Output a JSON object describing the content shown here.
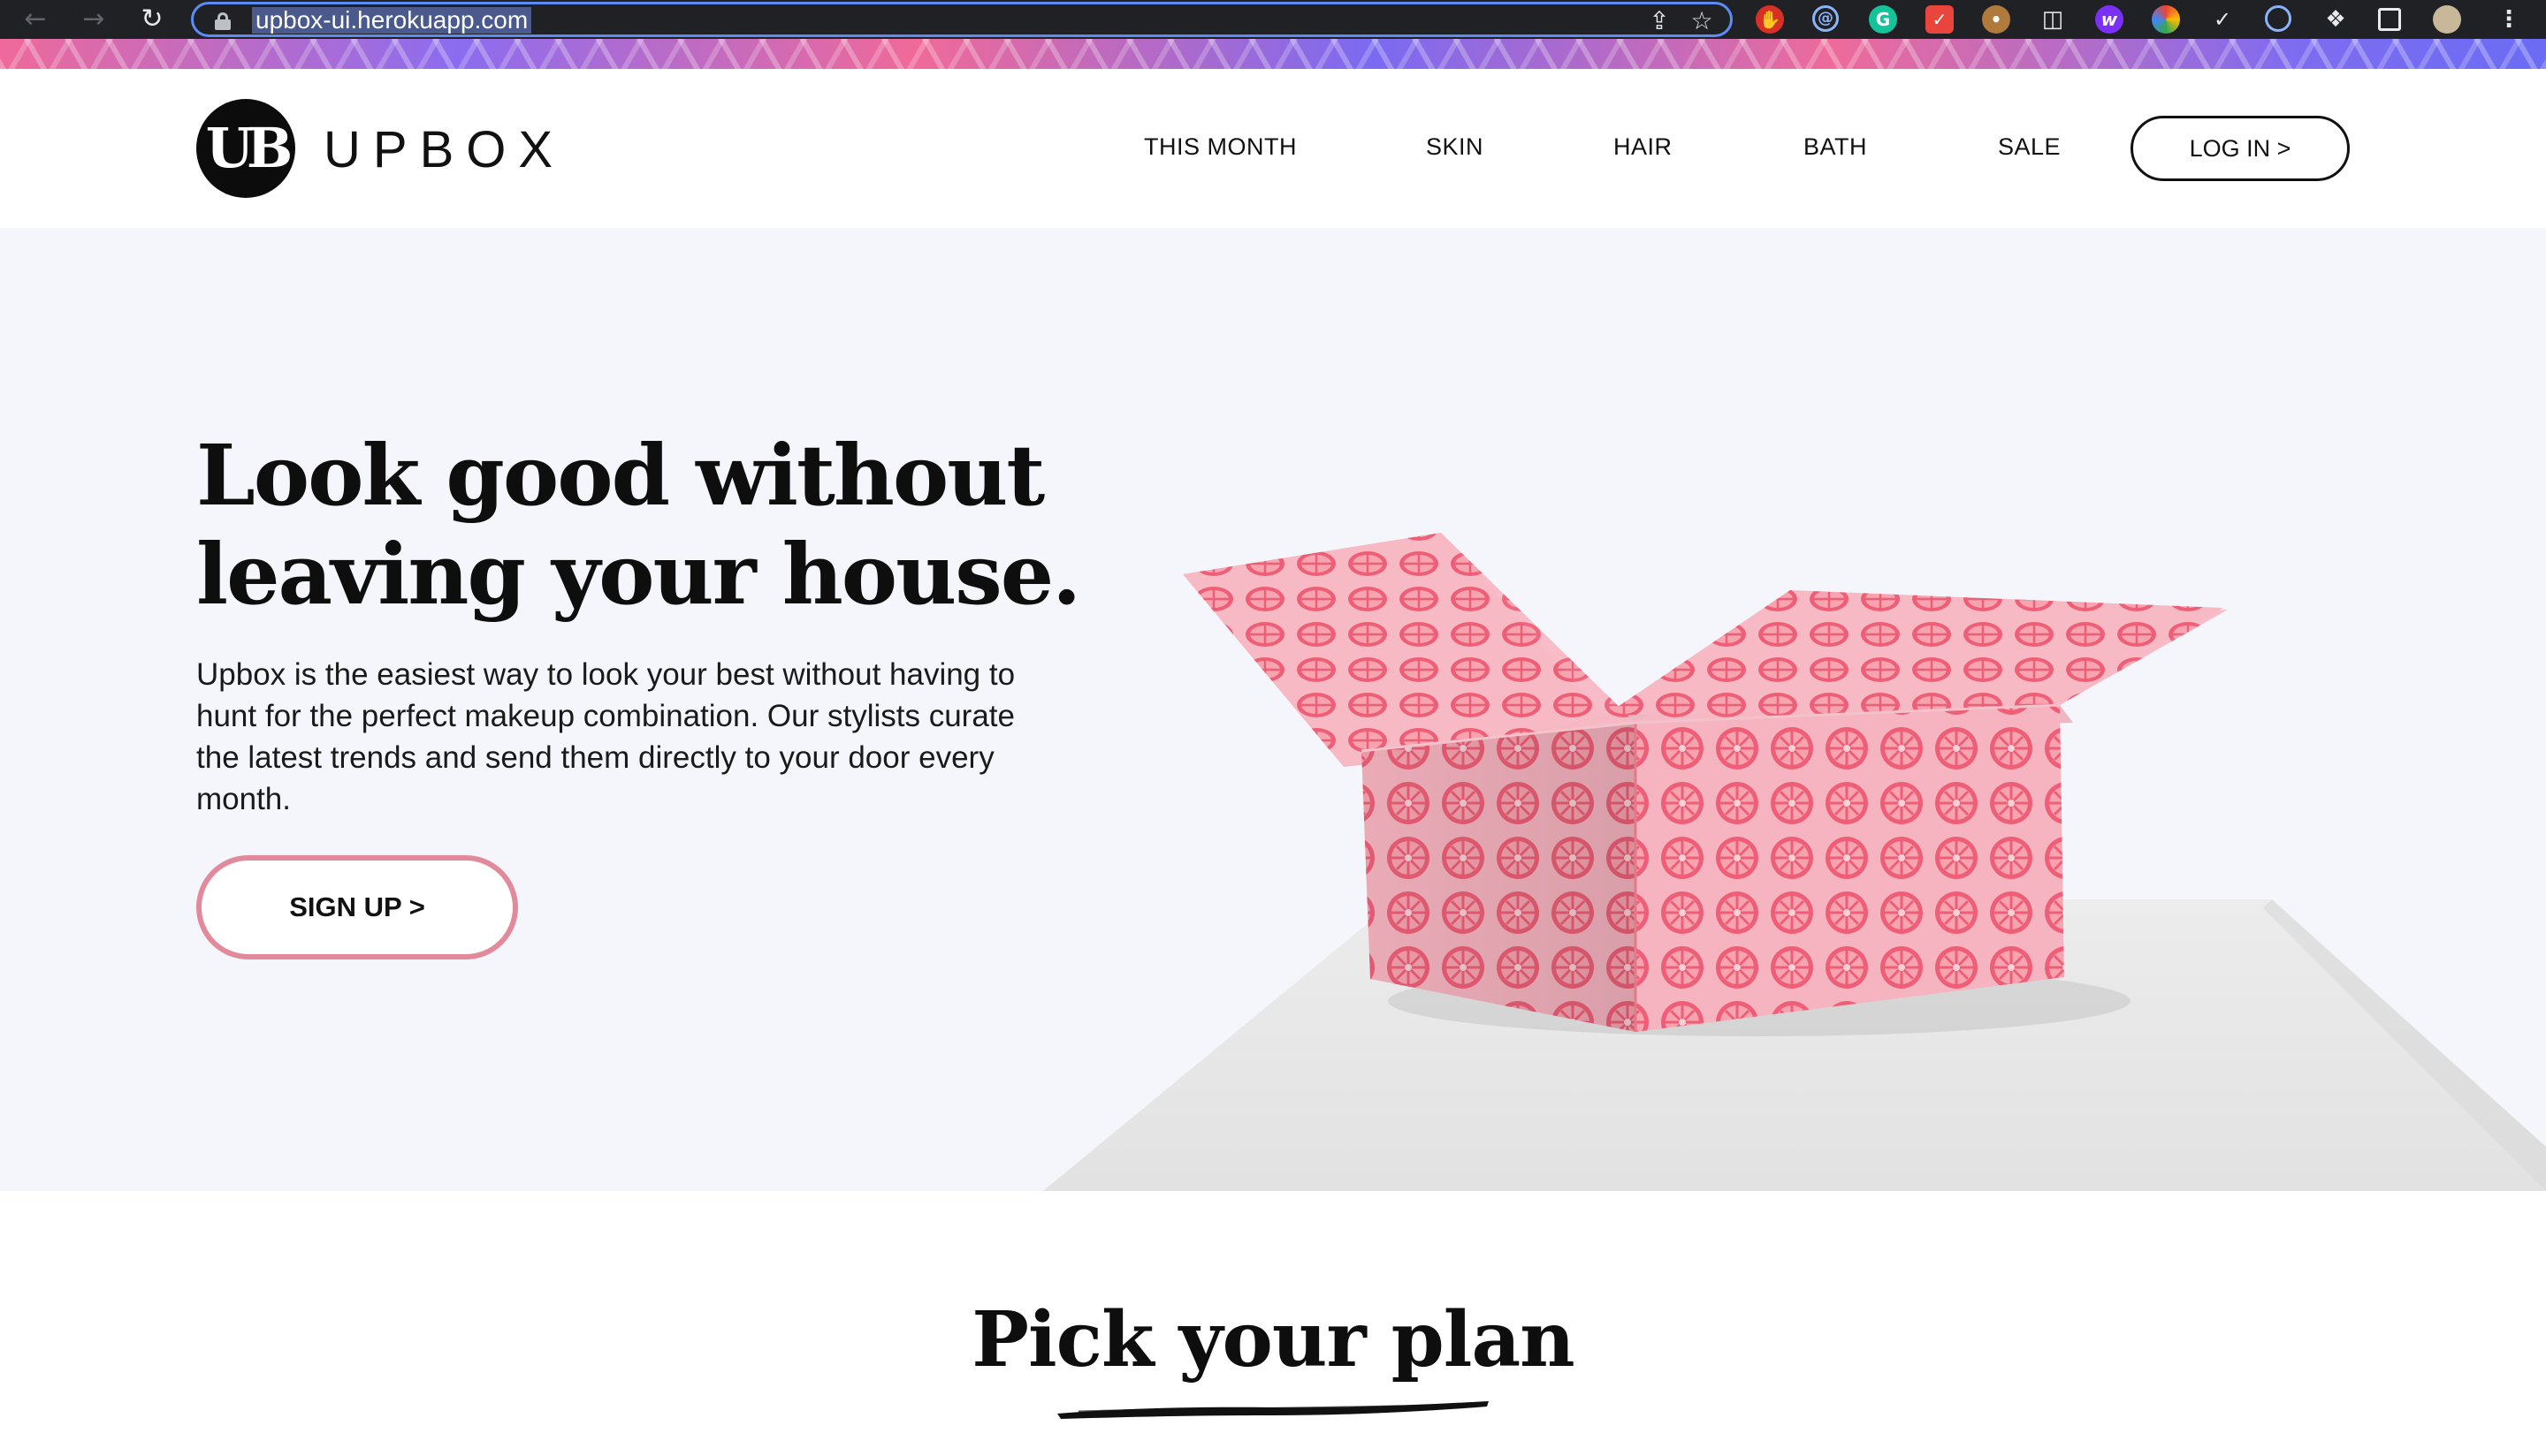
{
  "browser": {
    "url": "upbox-ui.herokuapp.com",
    "icons": {
      "back": "arrow-left-icon",
      "forward": "arrow-right-icon",
      "reload": "reload-icon",
      "lock": "lock-icon",
      "share": "share-icon",
      "bookmark": "star-icon"
    },
    "extensions": [
      "adblock-icon",
      "at-sign-icon",
      "grammarly-icon",
      "todo-icon",
      "cookie-icon",
      "reader-icon",
      "w-icon",
      "color-picker-icon",
      "eyedropper-icon",
      "target-icon",
      "puzzle-icon",
      "side-panel-icon",
      "profile-avatar",
      "menu-kebab-icon"
    ]
  },
  "header": {
    "logo_mark": "UB",
    "logo_text": "UPBOX",
    "nav": [
      "THIS MONTH",
      "SKIN",
      "HAIR",
      "BATH",
      "SALE"
    ],
    "login_label": "LOG IN >"
  },
  "hero": {
    "title_line1": "Look good without",
    "title_line2": "leaving your house.",
    "body": "Upbox is the easiest way to look your best without having to hunt for the perfect makeup combination. Our stylists curate the latest trends and send them directly to your door every month.",
    "signup_label": "SIGN UP >"
  },
  "plans": {
    "title": "Pick your plan"
  },
  "colors": {
    "accent_pink": "#e2899b",
    "box_pink": "#f4a9b6",
    "hero_bg": "#f5f6fb",
    "text_dark": "#0e0e0e"
  }
}
